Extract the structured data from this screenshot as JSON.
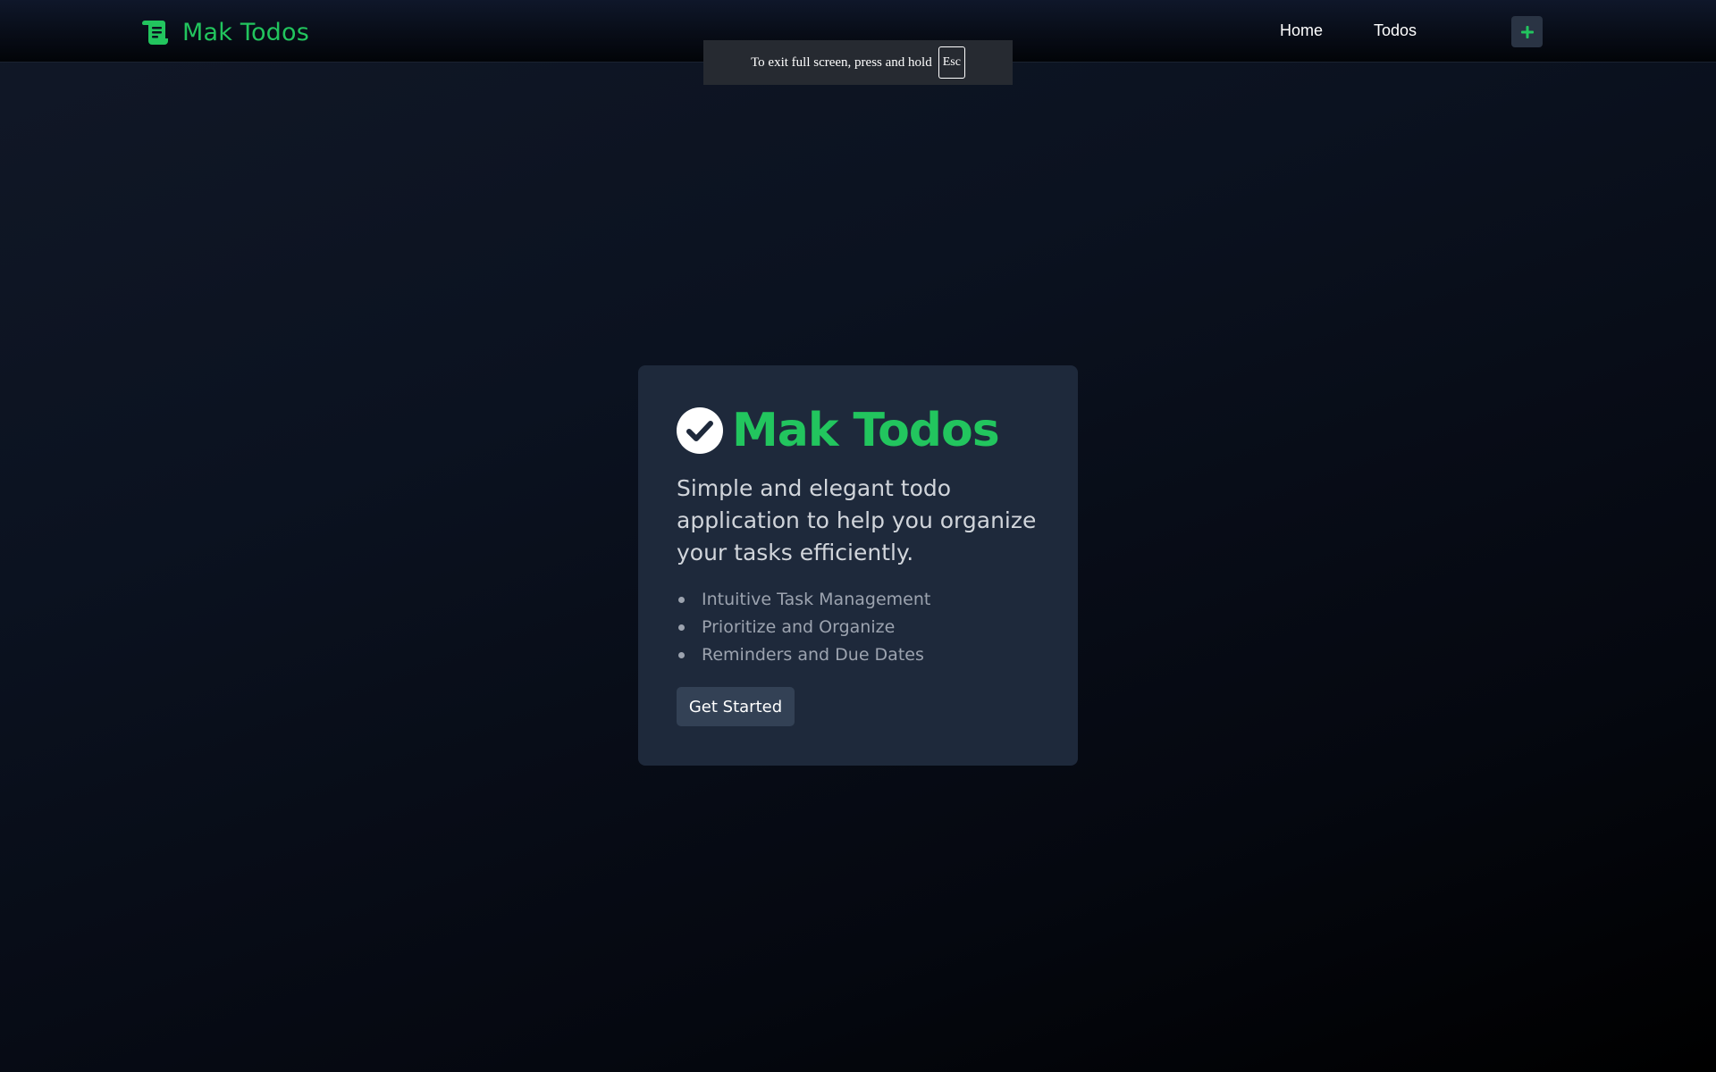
{
  "navbar": {
    "brand": {
      "icon": "scroll-icon",
      "label": "Mak Todos"
    },
    "links": [
      {
        "label": "Home"
      },
      {
        "label": "Todos"
      }
    ],
    "add_button": {
      "icon": "plus-icon"
    }
  },
  "fullscreen_notice": {
    "text": "To exit full screen, press and hold",
    "key": "Esc"
  },
  "hero": {
    "icon": "check-circle-icon",
    "title": "Mak Todos",
    "subtitle": "Simple and elegant todo application to help you organize your tasks efficiently.",
    "features": [
      "Intuitive Task Management",
      "Prioritize and Organize",
      "Reminders and Due Dates"
    ],
    "cta_label": "Get Started"
  },
  "colors": {
    "accent": "#22c55e",
    "card": "#1e293b",
    "button": "#334155"
  }
}
